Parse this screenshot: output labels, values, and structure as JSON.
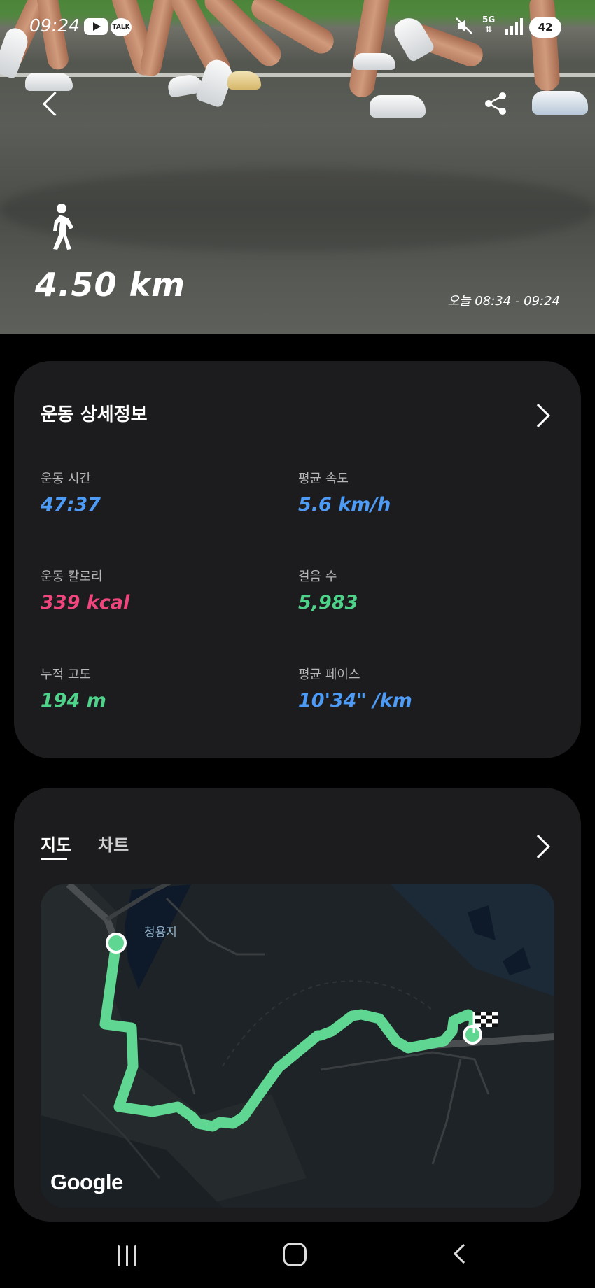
{
  "status_bar": {
    "time": "09:24",
    "network": "5G",
    "battery": "42"
  },
  "hero": {
    "distance": "4.50 km",
    "time_range": "오늘 08:34 - 09:24",
    "activity_icon": "walk-icon"
  },
  "details": {
    "title": "운동 상세정보",
    "stats": [
      {
        "label": "운동 시간",
        "value": "47:37",
        "color": "#4d9bf5"
      },
      {
        "label": "평균 속도",
        "value": "5.6 km/h",
        "color": "#4d9bf5"
      },
      {
        "label": "운동 칼로리",
        "value": "339 kcal",
        "color": "#f0467e"
      },
      {
        "label": "걸음 수",
        "value": "5,983",
        "color": "#4fd28a"
      },
      {
        "label": "누적 고도",
        "value": "194 m",
        "color": "#4fd28a"
      },
      {
        "label": "평균 페이스",
        "value": "10'34\" /km",
        "color": "#4d9bf5"
      }
    ]
  },
  "map_card": {
    "tabs": [
      {
        "label": "지도",
        "selected": true
      },
      {
        "label": "차트",
        "selected": false
      }
    ],
    "lake_label": "청용지",
    "provider": "Google",
    "route_color": "#5fd691"
  },
  "colors": {
    "card_bg": "#1c1c1e",
    "accent_blue": "#4d9bf5",
    "accent_pink": "#f0467e",
    "accent_green": "#4fd28a"
  }
}
